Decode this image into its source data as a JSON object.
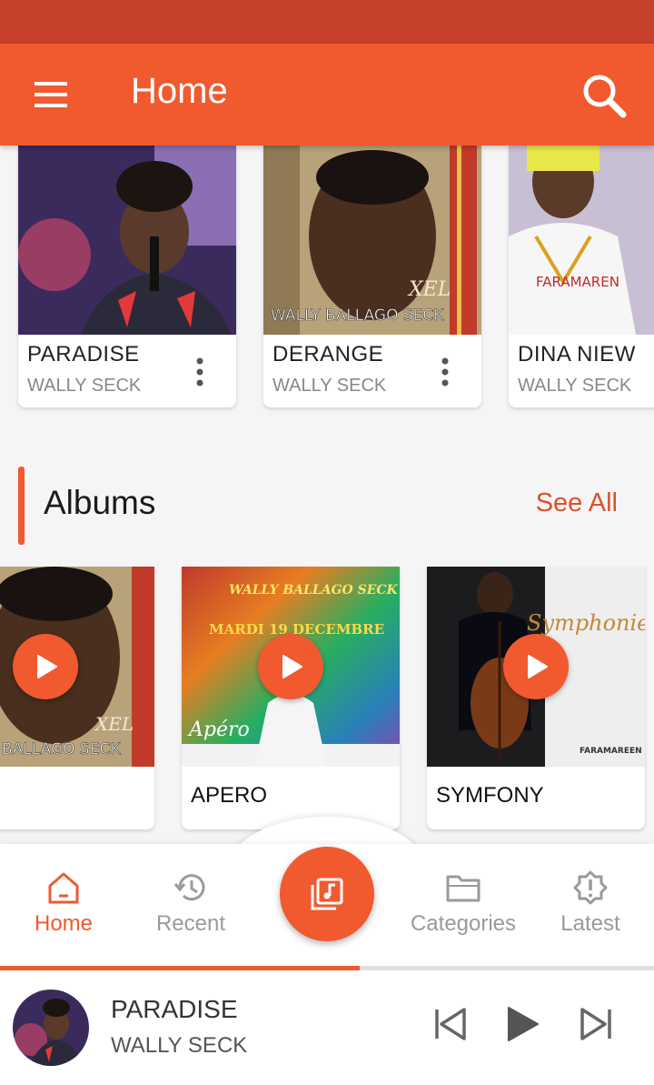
{
  "app": {
    "title": "Home"
  },
  "colors": {
    "accent": "#f1592f",
    "status_bar": "#c8412a"
  },
  "songs": [
    {
      "title": "PARADISE",
      "artist": "WALLY SECK",
      "art_text": ""
    },
    {
      "title": "DERANGE",
      "artist": "WALLY SECK",
      "art_text": "WALLY BALLAGO SECK",
      "art_sub": "XEL"
    },
    {
      "title": "DINA NIEW",
      "artist": "WALLY SECK",
      "art_text": "FARAMAREN"
    }
  ],
  "albums_section": {
    "title": "Albums",
    "see_all": "See All"
  },
  "albums": [
    {
      "title": "",
      "art_text": "BALLAGO SECK",
      "art_sub": "XEL"
    },
    {
      "title": "APERO",
      "art_text": "WALLY BALLAGO SECK",
      "art_date": "MARDI 19 DECEMBRE",
      "art_sub": "Apéro"
    },
    {
      "title": "SYMFONY",
      "art_text": "Symphonie",
      "art_sub": "FARAMAREEN"
    }
  ],
  "bottom_nav": {
    "items": [
      {
        "label": "Home",
        "icon": "home-icon",
        "active": true
      },
      {
        "label": "Recent",
        "icon": "history-icon",
        "active": false
      },
      {
        "label": "Categories",
        "icon": "folder-icon",
        "active": false
      },
      {
        "label": "Latest",
        "icon": "alert-badge-icon",
        "active": false
      }
    ],
    "center_icon": "music-library-icon"
  },
  "player": {
    "title": "PARADISE",
    "artist": "WALLY SECK",
    "progress": 0.55
  }
}
